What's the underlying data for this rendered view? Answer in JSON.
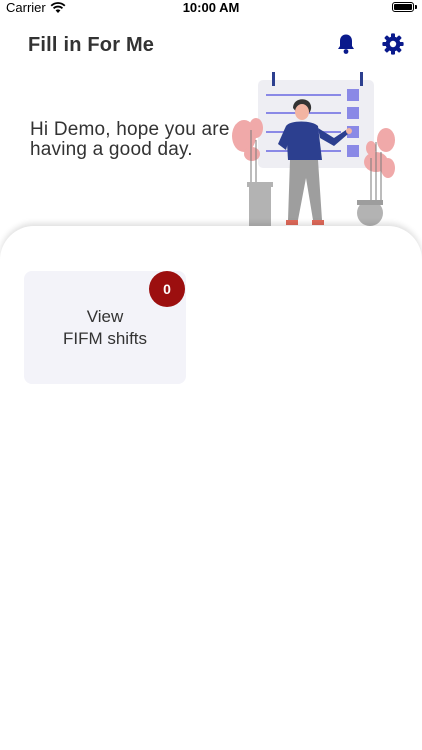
{
  "status_bar": {
    "carrier": "Carrier",
    "time": "10:00 AM"
  },
  "header": {
    "title": "Fill in For Me",
    "notification_icon": "bell-icon",
    "settings_icon": "gear-icon"
  },
  "hero": {
    "greeting": "Hi Demo, hope you are having a good day."
  },
  "tiles": [
    {
      "line1": "View",
      "line2": "FIFM shifts",
      "badge_count": "0"
    }
  ],
  "colors": {
    "accent": "#0a1a8c",
    "badge": "#9c0f0f",
    "tile_bg": "#f3f3f9"
  }
}
